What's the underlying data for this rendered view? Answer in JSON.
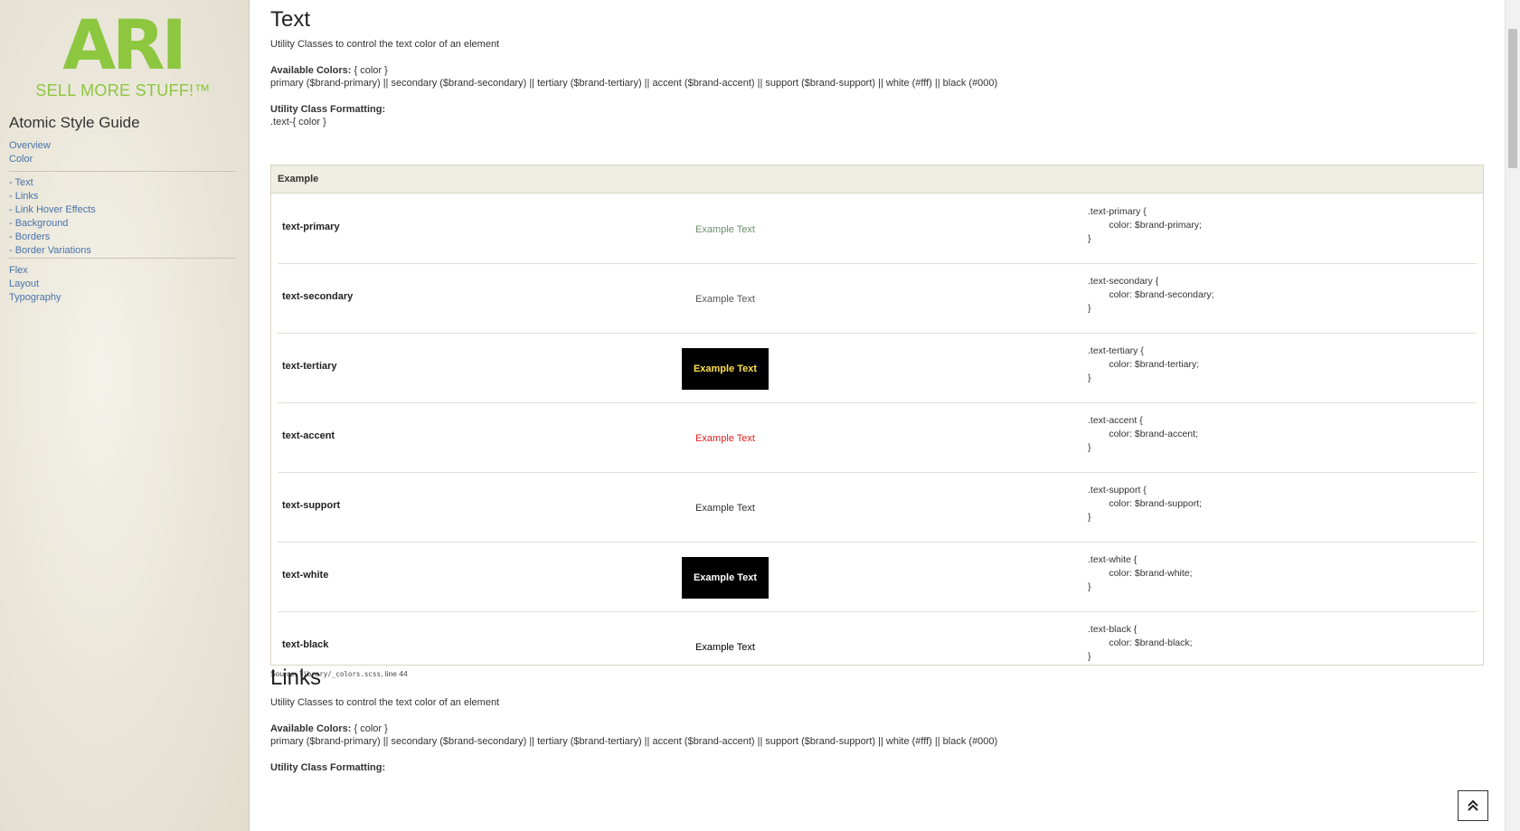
{
  "brand": {
    "logo_text": "ARI",
    "tagline": "SELL MORE STUFF!™",
    "title": "Atomic Style Guide",
    "logo_color": "#8dc63f"
  },
  "sidebar": {
    "top": [
      "Overview",
      "Color"
    ],
    "color_sub": [
      "- Text",
      "- Links",
      "- Link Hover Effects",
      "- Background",
      "- Borders",
      "- Border Variations"
    ],
    "bottom": [
      "Flex",
      "Layout",
      "Typography"
    ]
  },
  "text_section": {
    "title": "Text",
    "desc": "Utility Classes to control the text color of an element",
    "available_label": "Available Colors:",
    "available_value": "{ color }",
    "colors_line": "primary ($brand-primary) || secondary ($brand-secondary) || tertiary ($brand-tertiary) || accent ($brand-accent) || support ($brand-support) || white (#fff) || black (#000)",
    "format_label": "Utility Class Formatting:",
    "format_value": ".text-{ color }",
    "example_header": "Example",
    "rows": [
      {
        "name": "text-primary",
        "demo": "Example Text",
        "code": ".text-primary {\n        color: $brand-primary;\n}",
        "color": "#6b8e6b",
        "dark": false
      },
      {
        "name": "text-secondary",
        "demo": "Example Text",
        "code": ".text-secondary {\n        color: $brand-secondary;\n}",
        "color": "#555555",
        "dark": false
      },
      {
        "name": "text-tertiary",
        "demo": "Example Text",
        "code": ".text-tertiary {\n        color: $brand-tertiary;\n}",
        "color": "#ffe14d",
        "dark": true
      },
      {
        "name": "text-accent",
        "demo": "Example Text",
        "code": ".text-accent {\n        color: $brand-accent;\n}",
        "color": "#e41e1e",
        "dark": false
      },
      {
        "name": "text-support",
        "demo": "Example Text",
        "code": ".text-support {\n        color: $brand-support;\n}",
        "color": "#333333",
        "dark": false
      },
      {
        "name": "text-white",
        "demo": "Example Text",
        "code": ".text-white {\n        color: $brand-white;\n}",
        "color": "#ffffff",
        "dark": true
      },
      {
        "name": "text-black",
        "demo": "Example Text",
        "code": ".text-black {\n        color: $brand-black;\n}",
        "color": "#000000",
        "dark": false
      }
    ],
    "source_prefix": "Source:",
    "source_file": "library/_colors.scss",
    "source_suffix": ", line 44"
  },
  "links_section": {
    "title": "Links",
    "desc": "Utility Classes to control the text color of an element",
    "available_label": "Available Colors:",
    "available_value": "{ color }",
    "colors_line": "primary ($brand-primary) || secondary ($brand-secondary) || tertiary ($brand-tertiary) || accent ($brand-accent) || support ($brand-support) || white (#fff) || black (#000)",
    "format_label": "Utility Class Formatting:"
  },
  "back_to_top_icon": "double-chevron-up-icon"
}
